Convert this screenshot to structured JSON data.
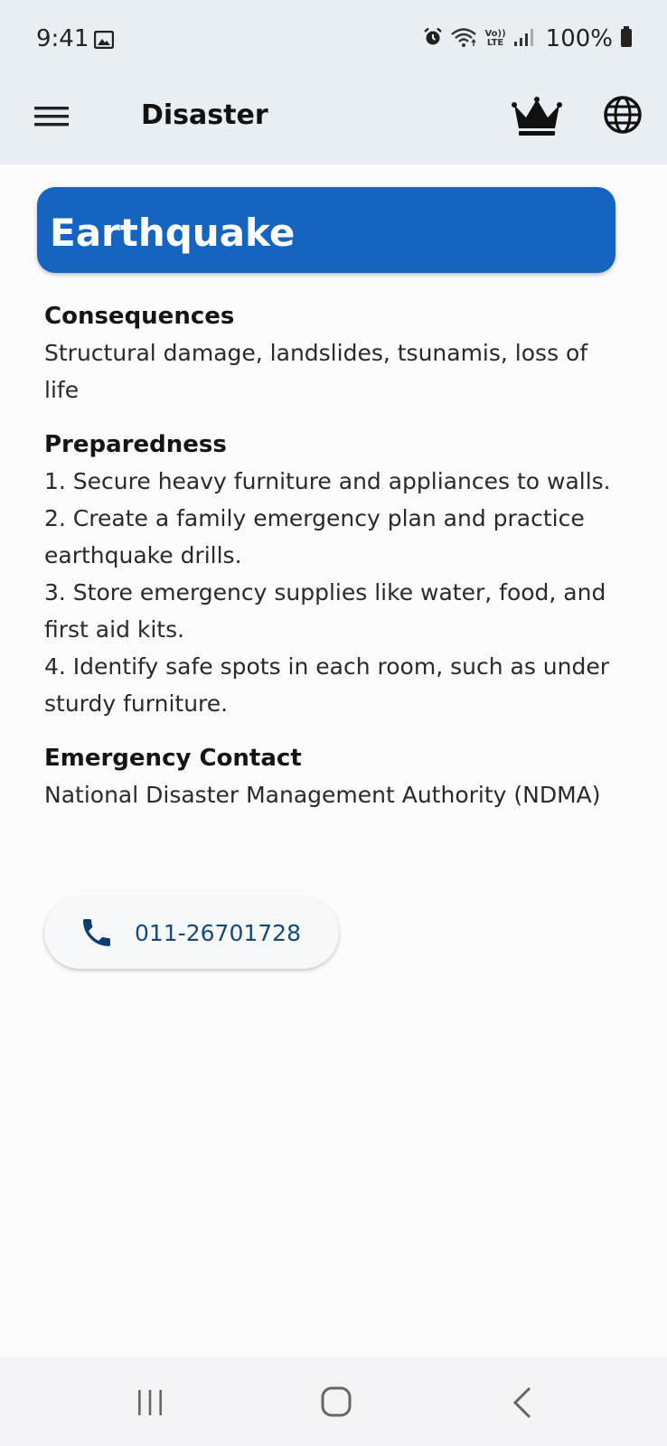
{
  "status_bar": {
    "time": "9:41",
    "battery": "100%",
    "network_top": "Vo))",
    "network_bottom": "LTE",
    "icons": [
      "image-icon",
      "alarm-icon",
      "wifi-icon",
      "signal-icon",
      "battery-icon"
    ]
  },
  "app_bar": {
    "title": "Disaster",
    "icons": [
      "menu-icon",
      "crown-icon",
      "globe-icon"
    ]
  },
  "disaster": {
    "name": "Earthquake",
    "accent_color": "#1565c0",
    "consequences_heading": "Consequences",
    "consequences_text": "Structural damage, landslides, tsunamis, loss of life",
    "preparedness_heading": "Preparedness",
    "preparedness_items": [
      "1. Secure heavy furniture and appliances to walls.",
      "2. Create a family emergency plan and practice earthquake drills.",
      "3. Store emergency supplies like water, food, and first aid kits.",
      "4. Identify safe spots in each room, such as under sturdy furniture."
    ],
    "contact_heading": "Emergency Contact",
    "contact_name": "National Disaster Management Authority (NDMA)",
    "contact_phone": "011-26701728",
    "phone_icon": "phone-icon"
  },
  "nav_bar": {
    "icons": [
      "recent-apps-icon",
      "home-icon",
      "back-icon"
    ]
  }
}
